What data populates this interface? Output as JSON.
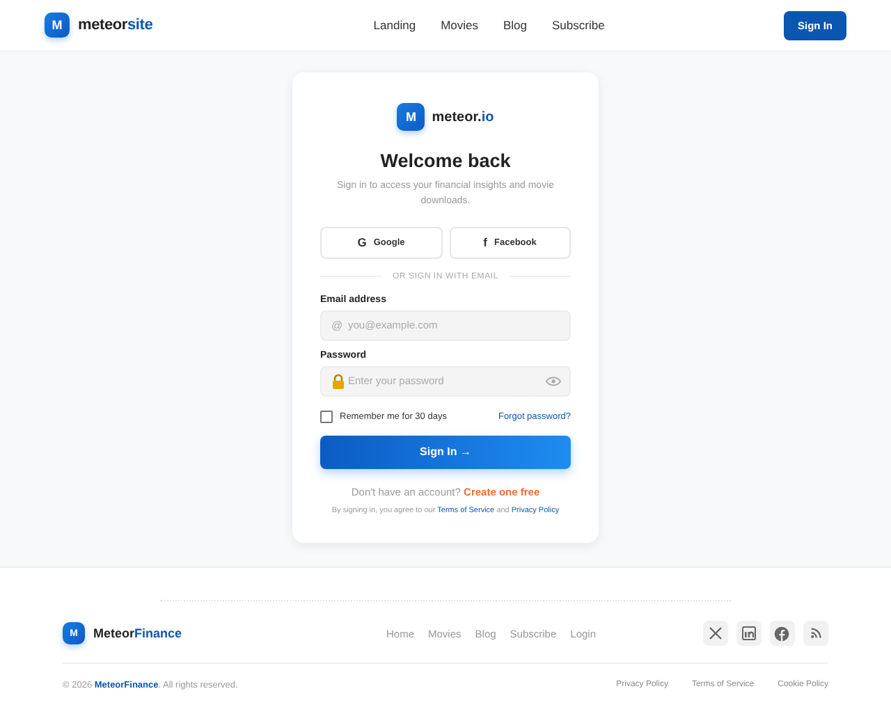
{
  "header": {
    "logo_letter": "M",
    "brand": {
      "main": "meteor",
      "accent": "site"
    },
    "nav": [
      "Landing",
      "Movies",
      "Blog",
      "Subscribe"
    ],
    "sign_in": "Sign In"
  },
  "card": {
    "logo_letter": "M",
    "brand": {
      "main": "meteor.",
      "accent": "io"
    },
    "title": "Welcome back",
    "subtitle": "Sign in to access your financial insights and movie downloads.",
    "social": [
      {
        "glyph": "G",
        "label": "Google"
      },
      {
        "glyph": "f",
        "label": "Facebook"
      }
    ],
    "divider": "OR SIGN IN WITH EMAIL",
    "fields": [
      {
        "kind": "email",
        "label": "Email address",
        "icon": "@",
        "placeholder": "you@example.com"
      },
      {
        "kind": "password",
        "label": "Password",
        "placeholder": "Enter your password"
      }
    ],
    "remember": {
      "label": "Remember me for 30 days",
      "checked": false
    },
    "forgot": "Forgot password?",
    "submit": "Sign In",
    "submit_arrow": "→",
    "signup_prompt": "Don't have an account?",
    "signup_link": "Create one free",
    "legal": {
      "prefix": "By signing in, you agree to our",
      "terms": "Terms of Service",
      "and": "and",
      "privacy": "Privacy Policy"
    }
  },
  "footer": {
    "logo_letter": "M",
    "brand": {
      "main": "Meteor",
      "accent": "Finance"
    },
    "nav": [
      "Home",
      "Movies",
      "Blog",
      "Subscribe",
      "Login"
    ],
    "social": [
      {
        "kind": "x"
      },
      {
        "kind": "linkedin"
      },
      {
        "kind": "facebook"
      },
      {
        "kind": "rss"
      }
    ],
    "copyright": {
      "prefix": "© 2026",
      "brand": "MeteorFinance",
      "suffix": ". All rights reserved."
    },
    "links": [
      "Privacy Policy",
      "Terms of Service",
      "Cookie Policy"
    ]
  }
}
